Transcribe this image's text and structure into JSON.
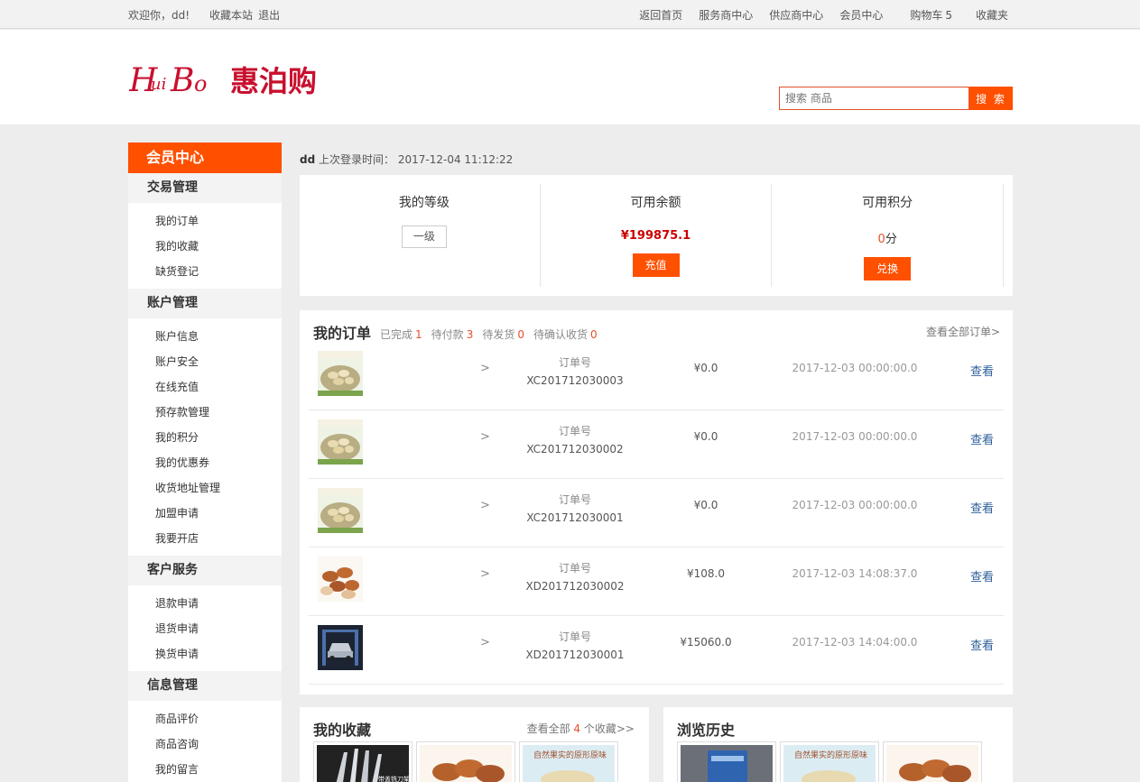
{
  "topbar": {
    "welcome": "欢迎你，dd!",
    "bookmark": "收藏本站",
    "logout": "退出",
    "links": [
      "返回首页",
      "服务商中心",
      "供应商中心",
      "会员中心"
    ],
    "cart_label": "购物车",
    "cart_count": "5",
    "favorites": "收藏夹"
  },
  "header": {
    "logo_text": "惠泊购",
    "search_placeholder": "搜索 商品",
    "search_button": "搜 索"
  },
  "sidebar": {
    "title": "会员中心",
    "groups": [
      {
        "label": "交易管理",
        "items": [
          "我的订单",
          "我的收藏",
          "缺货登记"
        ]
      },
      {
        "label": "账户管理",
        "items": [
          "账户信息",
          "账户安全",
          "在线充值",
          "预存款管理",
          "我的积分",
          "我的优惠券",
          "收货地址管理",
          "加盟申请",
          "我要开店"
        ]
      },
      {
        "label": "客户服务",
        "items": [
          "退款申请",
          "退货申请",
          "换货申请"
        ]
      },
      {
        "label": "信息管理",
        "items": [
          "商品评价",
          "商品咨询",
          "我的留言"
        ]
      }
    ]
  },
  "account": {
    "user": "dd",
    "last_login_label": "上次登录时间：",
    "last_login_time": "2017-12-04 11:12:22",
    "level_label": "我的等级",
    "level_value": "一级",
    "balance_label": "可用余额",
    "balance_value": "¥199875.1",
    "recharge_button": "充值",
    "points_label": "可用积分",
    "points_value": "0",
    "points_unit": "分",
    "exchange_button": "兑换"
  },
  "orders": {
    "title": "我的订单",
    "filters": [
      {
        "label": "已完成",
        "count": "1"
      },
      {
        "label": "待付款",
        "count": "3"
      },
      {
        "label": "待发货",
        "count": "0"
      },
      {
        "label": "待确认收货",
        "count": "0"
      }
    ],
    "view_all": "查看全部订单>",
    "order_no_label": "订单号",
    "arrow": ">",
    "view_label": "查看",
    "rows": [
      {
        "no": "XC201712030003",
        "amount": "¥0.0",
        "date": "2017-12-03 00:00:00.0",
        "thumb": "pistachio"
      },
      {
        "no": "XC201712030002",
        "amount": "¥0.0",
        "date": "2017-12-03 00:00:00.0",
        "thumb": "pistachio"
      },
      {
        "no": "XC201712030001",
        "amount": "¥0.0",
        "date": "2017-12-03 00:00:00.0",
        "thumb": "pistachio"
      },
      {
        "no": "XD201712030002",
        "amount": "¥108.0",
        "date": "2017-12-03 14:08:37.0",
        "thumb": "almond"
      },
      {
        "no": "XD201712030001",
        "amount": "¥15060.0",
        "date": "2017-12-03 14:04:00.0",
        "thumb": "car-lift"
      }
    ]
  },
  "favorites": {
    "title": "我的收藏",
    "more_prefix": "查看全部",
    "count": "4",
    "more_suffix": "个收藏>>",
    "items": [
      {
        "thumb": "knife-set",
        "caption": "带盖铣刀架"
      },
      {
        "thumb": "almond",
        "caption": ""
      },
      {
        "thumb": "pistachio-banner",
        "caption": "自然果实的原形原味"
      }
    ]
  },
  "history": {
    "title": "浏览历史",
    "items": [
      {
        "thumb": "machine"
      },
      {
        "thumb": "pistachio-banner",
        "caption": "自然果实的原形原味"
      },
      {
        "thumb": "almond"
      }
    ]
  },
  "colors": {
    "accent": "#ff5000",
    "price_red": "#cc0000",
    "link_blue": "#2d5f9a"
  }
}
